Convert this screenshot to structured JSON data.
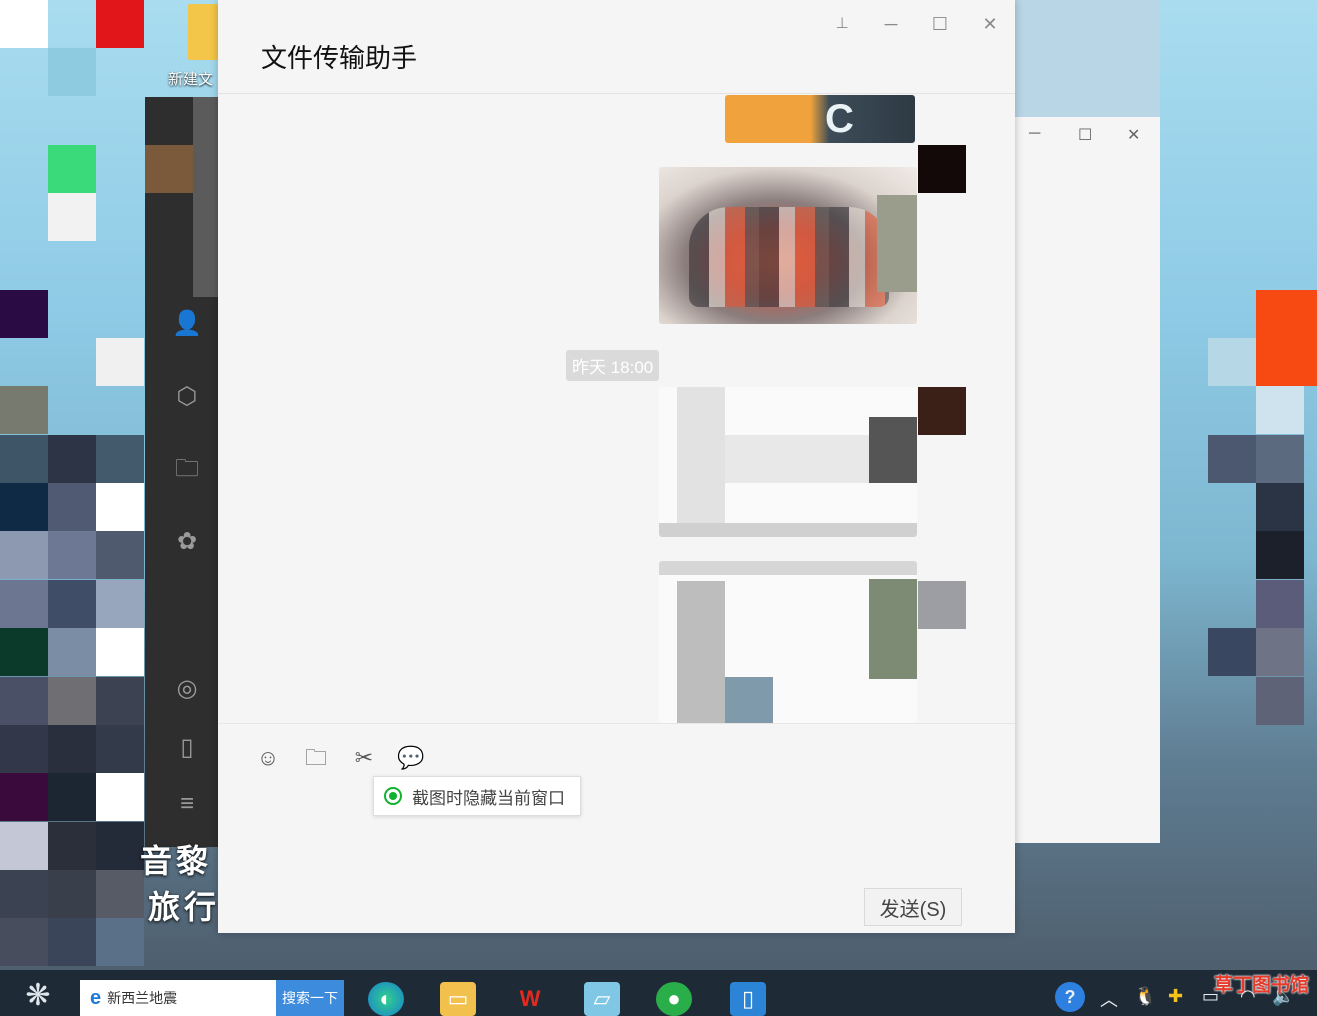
{
  "desktop": {
    "icon_label": "新建文"
  },
  "background_text": {
    "line1": "音黎",
    "line2": "旅行"
  },
  "chat_window": {
    "title": "文件传输助手",
    "timestamp": "昨天 18:00",
    "tooltip_text": "截图时隐藏当前窗口",
    "send_label": "发送(S)",
    "icons": {
      "pin": "pin-icon",
      "minimize": "minimize-icon",
      "maximize": "maximize-icon",
      "close": "close-icon",
      "emoji": "emoji-icon",
      "folder": "folder-icon",
      "scissors": "scissors-icon",
      "chat_history": "chat-bubble-icon"
    }
  },
  "taskbar": {
    "search_query": "新西兰地震",
    "search_button": "搜索一下"
  },
  "watermark": "草丁图书馆",
  "colors": {
    "accent_green": "#0fb32f",
    "window_bg": "#f5f5f5",
    "sidebar_dark": "#2e2e2e",
    "taskbar": "#1e2a36"
  }
}
